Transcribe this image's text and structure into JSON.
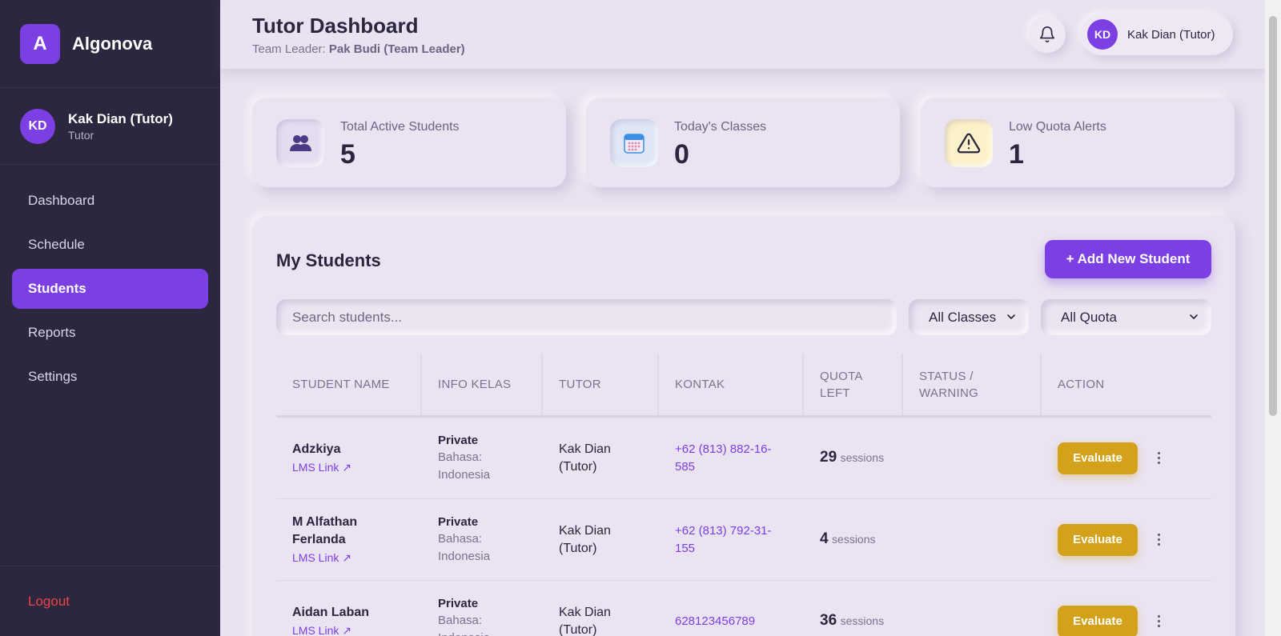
{
  "brand": {
    "logo_letter": "A",
    "name": "Algonova"
  },
  "sidebar": {
    "user": {
      "initials": "KD",
      "name": "Kak Dian (Tutor)",
      "role": "Tutor"
    },
    "items": [
      {
        "label": "Dashboard",
        "active": false
      },
      {
        "label": "Schedule",
        "active": false
      },
      {
        "label": "Students",
        "active": true
      },
      {
        "label": "Reports",
        "active": false
      },
      {
        "label": "Settings",
        "active": false
      }
    ],
    "logout_label": "Logout"
  },
  "header": {
    "title": "Tutor Dashboard",
    "subtitle_prefix": "Team Leader:",
    "team_leader": "Pak Budi (Team Leader)",
    "user_initials": "KD",
    "user_name": "Kak Dian (Tutor)",
    "notification_icon": "bell-icon"
  },
  "stats": [
    {
      "label": "Total Active Students",
      "value": "5",
      "icon": "users-icon"
    },
    {
      "label": "Today's Classes",
      "value": "0",
      "icon": "calendar-icon"
    },
    {
      "label": "Low Quota Alerts",
      "value": "1",
      "icon": "warning-icon"
    }
  ],
  "students": {
    "title": "My Students",
    "add_button": "+ Add New Student",
    "search_placeholder": "Search students...",
    "class_filter": "All Classes",
    "quota_filter": "All Quota",
    "columns": [
      "STUDENT NAME",
      "INFO KELAS",
      "TUTOR",
      "KONTAK",
      "QUOTA LEFT",
      "STATUS / WARNING",
      "ACTION"
    ],
    "rows": [
      {
        "name": "Adzkiya",
        "lms": "LMS Link ↗",
        "class_type": "Private",
        "language": "Bahasa: Indonesia",
        "tutor": "Kak Dian (Tutor)",
        "contact": "+62 (813) 882-16-585",
        "quota": "29",
        "quota_unit": "sessions",
        "status": "",
        "action": "Evaluate"
      },
      {
        "name": "M Alfathan Ferlanda",
        "lms": "LMS Link ↗",
        "class_type": "Private",
        "language": "Bahasa: Indonesia",
        "tutor": "Kak Dian (Tutor)",
        "contact": "+62 (813) 792-31-155",
        "quota": "4",
        "quota_unit": "sessions",
        "status": "",
        "action": "Evaluate"
      },
      {
        "name": "Aidan Laban",
        "lms": "LMS Link ↗",
        "class_type": "Private",
        "language": "Bahasa: Indonesia",
        "tutor": "Kak Dian (Tutor)",
        "contact": "628123456789",
        "quota": "36",
        "quota_unit": "sessions",
        "status": "",
        "action": "Evaluate"
      }
    ]
  },
  "colors": {
    "accent": "#7b3fe4",
    "sidebar_bg": "#2c273f",
    "evaluate": "#d4a21a",
    "logout": "#e84545"
  }
}
